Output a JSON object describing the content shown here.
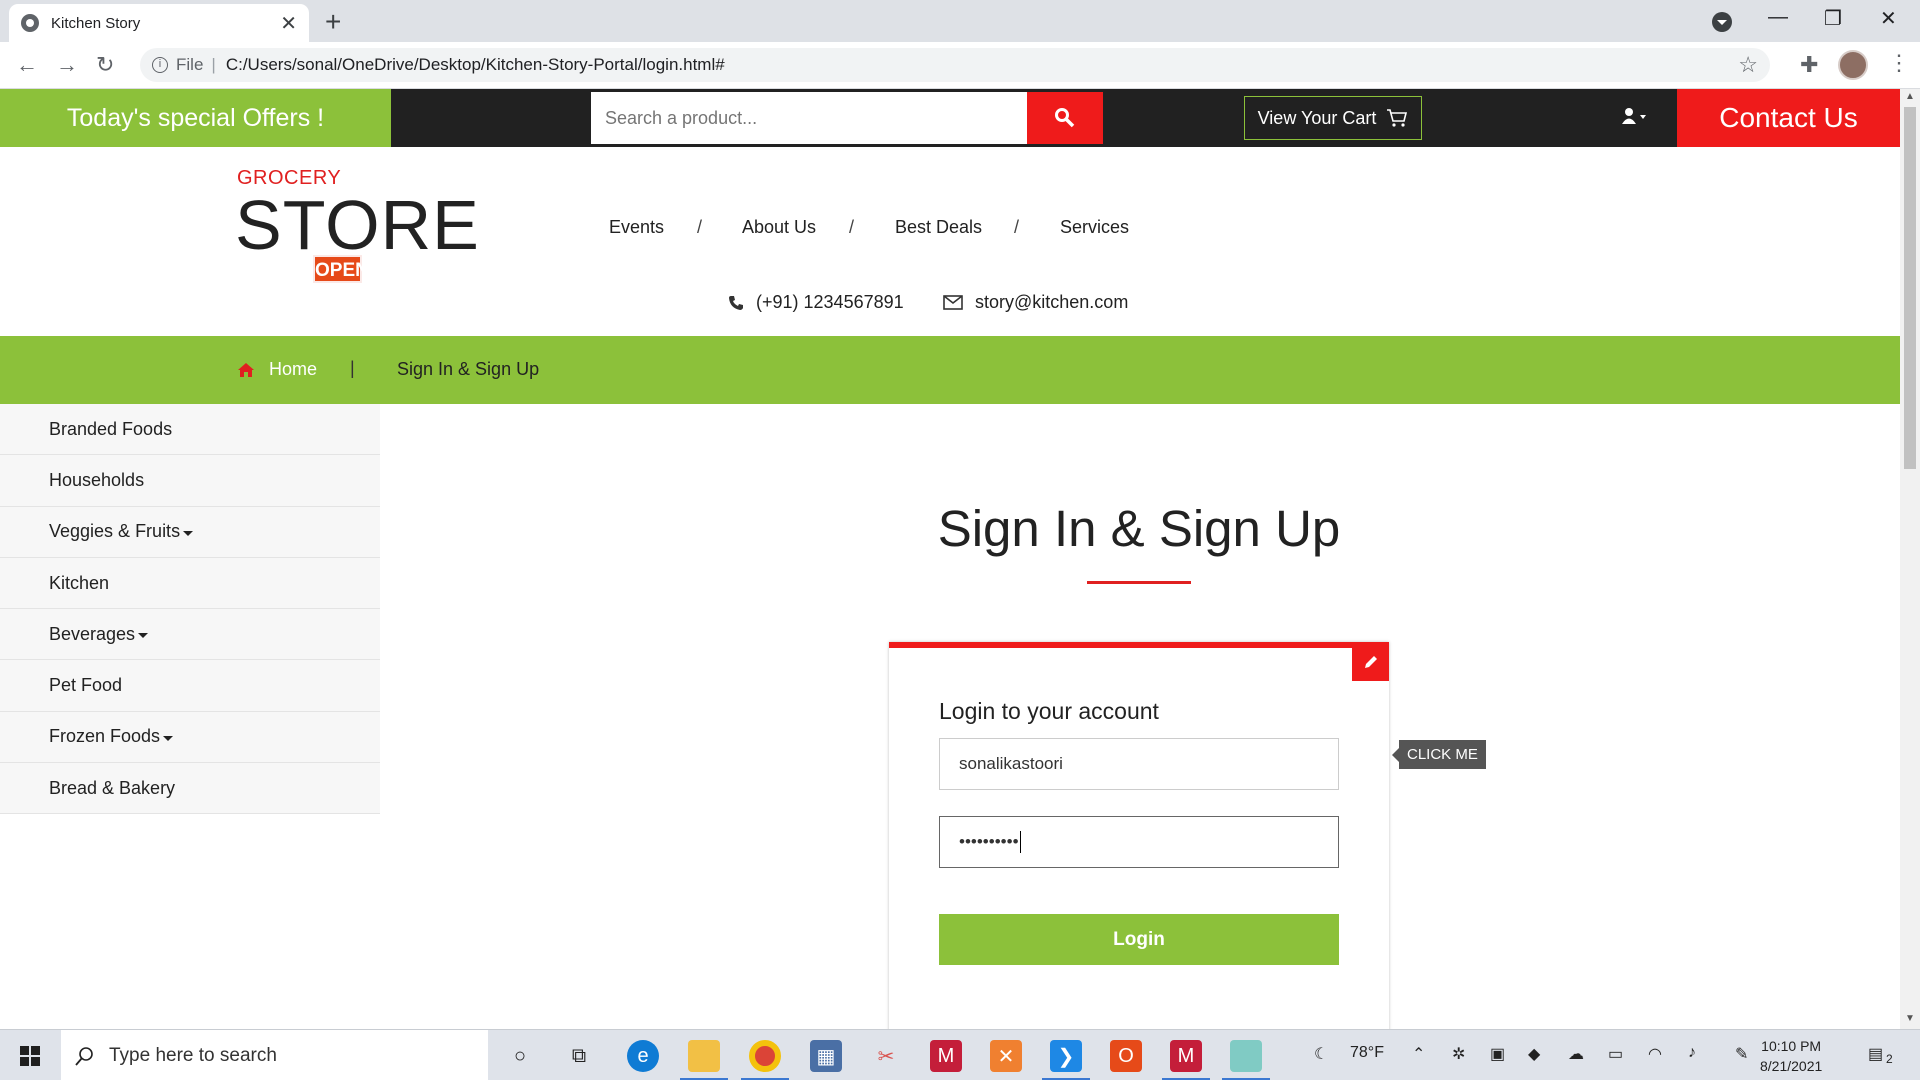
{
  "browser": {
    "tab_title": "Kitchen Story",
    "new_tab": "+",
    "url_prefix": "File",
    "url": "C:/Users/sonal/OneDrive/Desktop/Kitchen-Story-Portal/login.html#"
  },
  "topbar": {
    "offers": "Today's special Offers !",
    "search_placeholder": "Search a product...",
    "cart_label": "View Your Cart",
    "contact_label": "Contact Us"
  },
  "logo": {
    "small": "GROCERY",
    "big": "STORE",
    "sign": "OPEN"
  },
  "nav": {
    "items": [
      "Events",
      "About Us",
      "Best Deals",
      "Services"
    ],
    "separator": "/"
  },
  "contact_info": {
    "phone": "(+91) 1234567891",
    "email": "story@kitchen.com"
  },
  "breadcrumb": {
    "home": "Home",
    "separator": "|",
    "current": "Sign In & Sign Up"
  },
  "sidebar": {
    "items": [
      {
        "label": "Branded Foods",
        "dropdown": false
      },
      {
        "label": "Households",
        "dropdown": false
      },
      {
        "label": "Veggies & Fruits",
        "dropdown": true
      },
      {
        "label": "Kitchen",
        "dropdown": false
      },
      {
        "label": "Beverages",
        "dropdown": true
      },
      {
        "label": "Pet Food",
        "dropdown": false
      },
      {
        "label": "Frozen Foods",
        "dropdown": true
      },
      {
        "label": "Bread & Bakery",
        "dropdown": false
      }
    ]
  },
  "signin": {
    "title": "Sign In & Sign Up",
    "form_heading": "Login to your account",
    "username_value": "sonalikastoori",
    "password_value": "••••••••••",
    "login_button": "Login",
    "toggle_tooltip": "CLICK ME"
  },
  "taskbar": {
    "search_placeholder": "Type here to search",
    "weather": "78°F",
    "time": "10:10 PM",
    "date": "8/21/2021",
    "notification_count": "2"
  },
  "colors": {
    "green": "#8cc13a",
    "red": "#ef1b1b",
    "dark": "#212121"
  }
}
